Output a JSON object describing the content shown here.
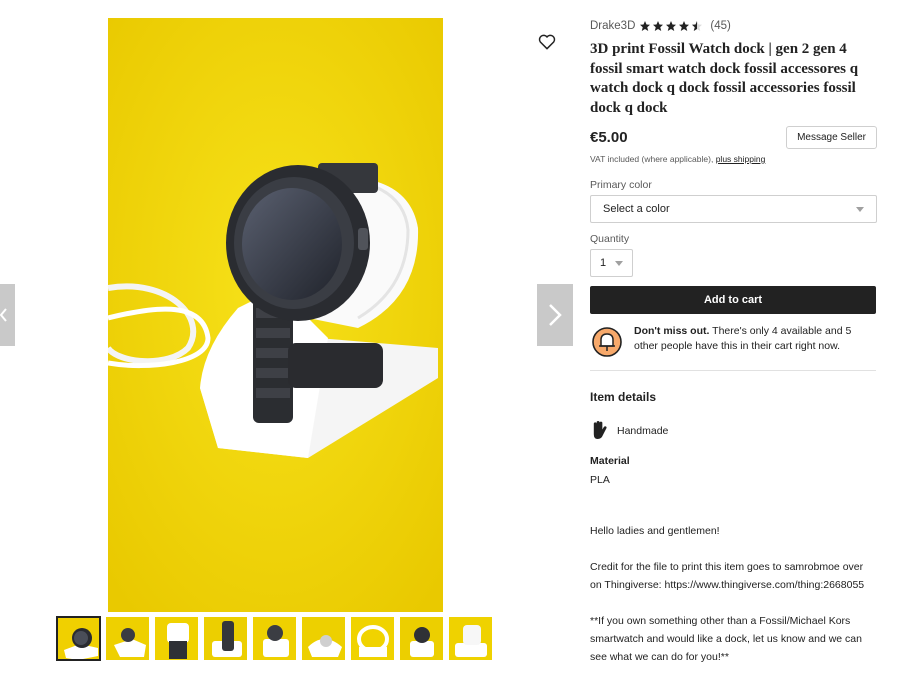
{
  "gallery": {
    "prev_icon": "chevron-left-icon",
    "next_icon": "chevron-right-icon",
    "favorite_icon": "heart-icon",
    "thumbnail_count": 9,
    "background_color": "#f2d300"
  },
  "listing": {
    "shop_name": "Drake3D",
    "rating": 4.5,
    "review_count": "(45)",
    "title": "3D print Fossil Watch dock | gen 2 gen 4 fossil smart watch dock fossil accessores q watch dock q dock fossil accessories fossil dock q dock",
    "price": "€5.00",
    "message_seller": "Message Seller",
    "vat_text": "VAT included (where applicable),",
    "shipping_link": "plus shipping"
  },
  "options": {
    "color_label": "Primary color",
    "color_value": "Select a color",
    "quantity_label": "Quantity",
    "quantity_value": "1"
  },
  "cart": {
    "add_label": "Add to cart",
    "scarcity_bold": "Don't miss out.",
    "scarcity_text": " There's only 4 available and 5 other people have this in their cart right now."
  },
  "details": {
    "heading": "Item details",
    "handmade": "Handmade",
    "material_label": "Material",
    "material_value": "PLA",
    "description": "Hello ladies and gentlemen!\n\nCredit for the file to print this item goes to samrobmoe over on Thingiverse: https://www.thingiverse.com/thing:2668055\n\n**If you own something other than a Fossil/Michael Kors smartwatch and would like a dock, let us know and we can see what we can do for you!**"
  },
  "colors": {
    "accent_yellow": "#f2d300",
    "button_dark": "#222222",
    "star": "#222222"
  }
}
